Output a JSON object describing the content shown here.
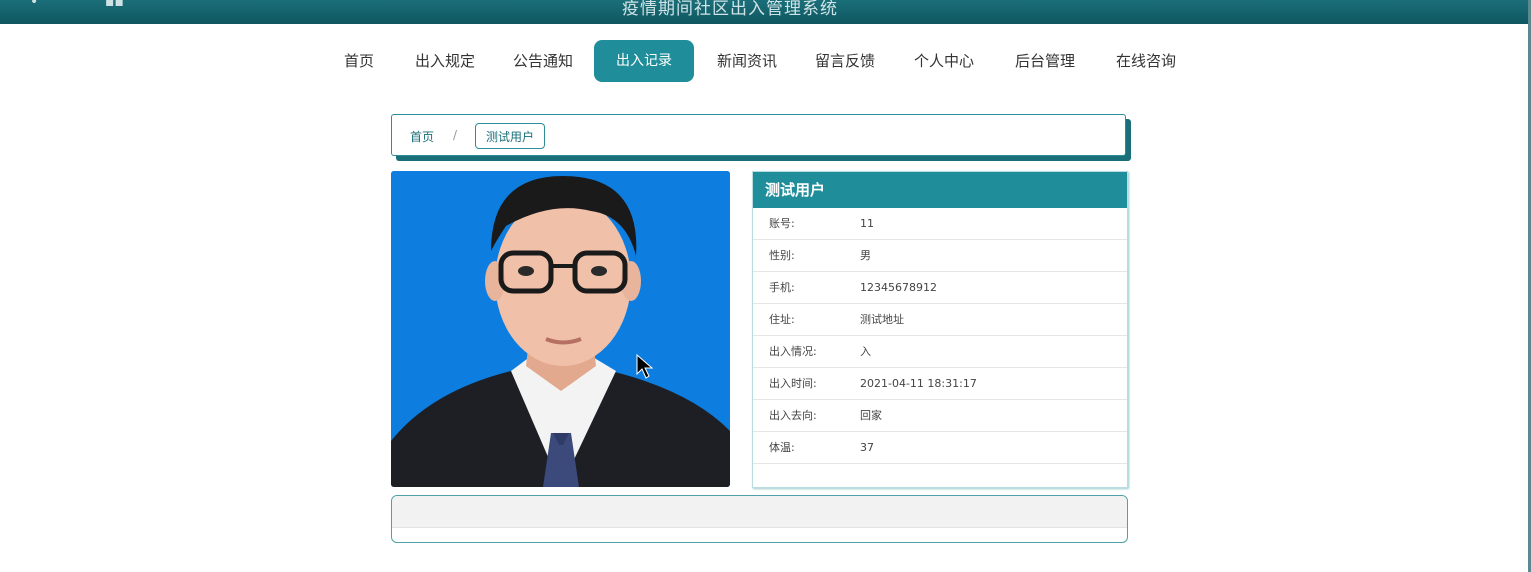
{
  "header": {
    "title": "疫情期间社区出入管理系统"
  },
  "nav": {
    "items": [
      "首页",
      "出入规定",
      "公告通知",
      "出入记录",
      "新闻资讯",
      "留言反馈",
      "个人中心",
      "后台管理",
      "在线咨询"
    ],
    "active": "出入记录"
  },
  "breadcrumb": {
    "home": "首页",
    "separator": "/",
    "current": "测试用户"
  },
  "profile": {
    "name": "测试用户",
    "rows": [
      {
        "label": "账号:",
        "value": "11"
      },
      {
        "label": "性别:",
        "value": "男"
      },
      {
        "label": "手机:",
        "value": "12345678912"
      },
      {
        "label": "住址:",
        "value": "测试地址"
      },
      {
        "label": "出入情况:",
        "value": "入"
      },
      {
        "label": "出入时间:",
        "value": "2021-04-11 18:31:17"
      },
      {
        "label": "出入去向:",
        "value": "回家"
      },
      {
        "label": "体温:",
        "value": "37"
      }
    ]
  },
  "colors": {
    "primary": "#1f8e9a",
    "header_bg": "#0f5660",
    "photo_bg": "#0d7ee0"
  }
}
